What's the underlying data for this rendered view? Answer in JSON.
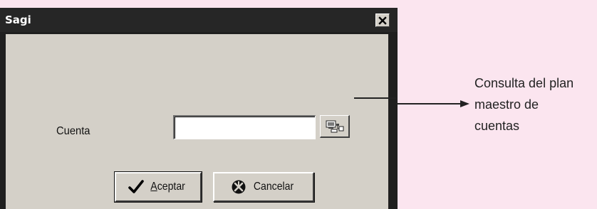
{
  "window": {
    "title": "Sagi"
  },
  "form": {
    "account_label": "Cuenta",
    "account_value": "",
    "accept_label": "Aceptar",
    "cancel_label": "Cancelar"
  },
  "annotation": {
    "lines": [
      "Consulta del plan",
      "maestro de",
      "cuentas"
    ]
  },
  "colors": {
    "page_background": "#fbe5ef",
    "window_chrome": "#1f1f1f",
    "dialog_face": "#d4d0c8"
  },
  "icons": {
    "close": "close-icon",
    "lookup": "account-lookup-icon",
    "accept": "checkmark-icon",
    "cancel": "cancel-icon"
  }
}
